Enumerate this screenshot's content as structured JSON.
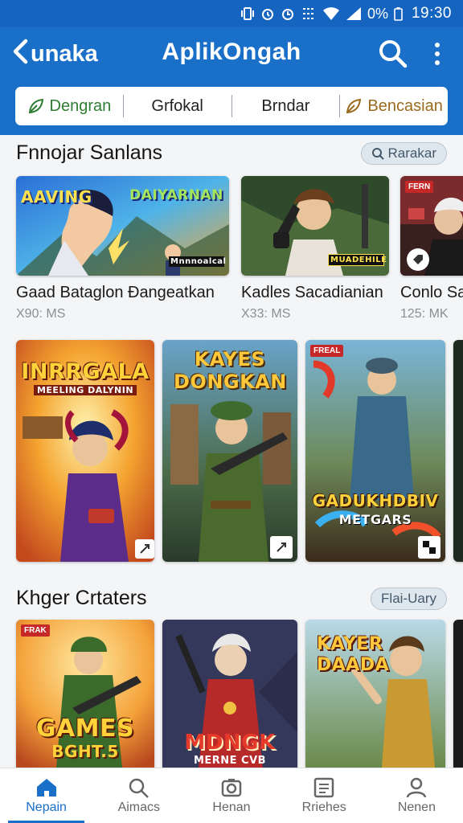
{
  "status_bar": {
    "battery": "0%",
    "time": "19:30"
  },
  "app_bar": {
    "back_label": "unaka",
    "title": "AplikOngah",
    "filters": [
      "Dengran",
      "Grfokal",
      "Brndar",
      "Bencasian"
    ]
  },
  "section1": {
    "title": "Fnnojar Sanlans",
    "chip": "Rarakar",
    "cards": [
      {
        "title": "Gaad Bataglon Đangeatkan",
        "meta": "X90: MS",
        "art_top": "AAVING",
        "art_right": "DAIYARNAN",
        "art_sub": "Mnnnoalcal"
      },
      {
        "title": "Kadles Sacadianian",
        "meta": "X33: MS",
        "art_sub": "MUADEHILE"
      },
      {
        "title": "Conlo Sa",
        "meta": "125: MK",
        "art_tag": "FERN"
      }
    ]
  },
  "section2": {
    "cards": [
      {
        "art_top": "INRRGALA",
        "art_sub": "MEELING DALYNIN"
      },
      {
        "art_top": "KAYES DONGKAN"
      },
      {
        "art_tag": "FREAL",
        "art_top": "GADUKHDBIV",
        "art_sub": "METGARS"
      }
    ]
  },
  "section3": {
    "title": "Khger Crtaters",
    "chip": "Flai-Uary",
    "cards": [
      {
        "art_tag": "FRAK",
        "art_top": "GAMES",
        "art_sub": "BGHT.5"
      },
      {
        "art_top": "MDNGK",
        "art_sub": "MERNE CVB"
      },
      {
        "art_top": "KAYER DAADA"
      }
    ]
  },
  "bottom_nav": [
    "Nepain",
    "Aimacs",
    "Henan",
    "Rriehes",
    "Nenen"
  ],
  "colors": {
    "primary": "#1a6fc9",
    "status": "#1565c0",
    "active_filter": "#2e7d32"
  }
}
